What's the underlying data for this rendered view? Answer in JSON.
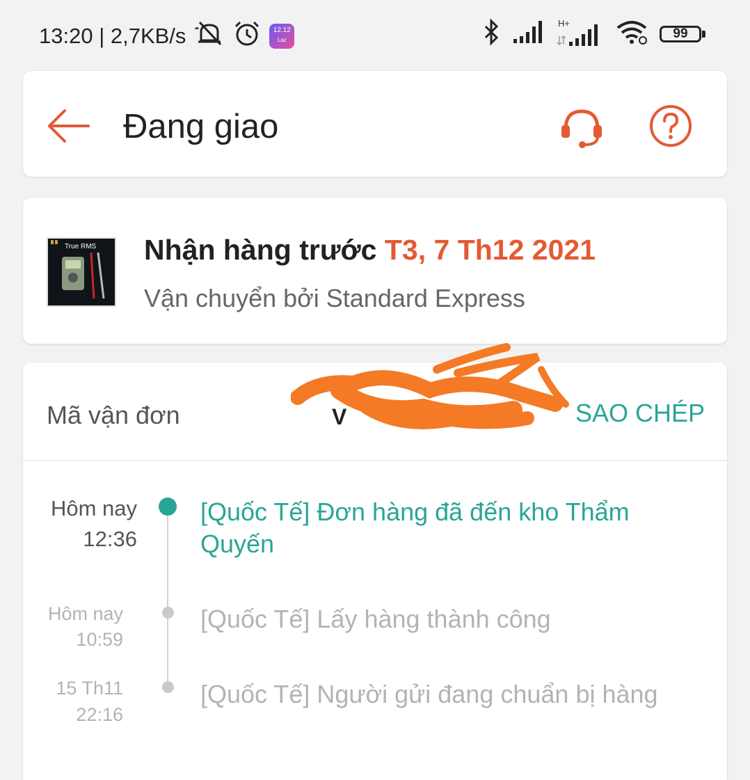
{
  "status_bar": {
    "time_speed": "13:20 | 2,7KB/s",
    "network_type": "H+",
    "battery": "99",
    "app_badge": "12.12",
    "app_badge_sub": "Laz",
    "icons": [
      "mute-icon",
      "alarm-icon",
      "lazada-app-icon",
      "bluetooth-icon",
      "signal-icon",
      "signal-hplus-icon",
      "wifi-icon",
      "battery-icon"
    ]
  },
  "header": {
    "title": "Đang giao",
    "back_icon": "arrow-left-icon",
    "support_icon": "headset-icon",
    "help_icon": "question-circle-icon",
    "accent_color": "#e35a33"
  },
  "delivery": {
    "label": "Nhận hàng trước",
    "date": "T3, 7 Th12 2021",
    "carrier": "Vận chuyển bởi Standard Express",
    "product_thumb_text": "True RMS"
  },
  "tracking": {
    "label": "Mã vận đơn",
    "value": "V",
    "copy_label": "SAO CHÉP",
    "copy_color": "#2aa595",
    "events": [
      {
        "date": "Hôm nay",
        "time": "12:36",
        "text": "[Quốc Tế] Đơn hàng đã đến kho Thẩm Quyến",
        "active": true
      },
      {
        "date": "Hôm nay",
        "time": "10:59",
        "text": "[Quốc Tế] Lấy hàng thành công",
        "active": false
      },
      {
        "date": "15 Th11",
        "time": "22:16",
        "text": "[Quốc Tế] Người gửi đang chuẩn bị hàng",
        "active": false
      }
    ]
  }
}
